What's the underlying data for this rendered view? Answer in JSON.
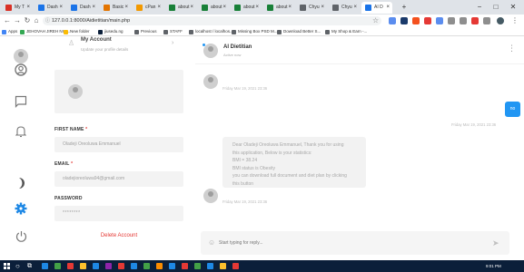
{
  "browser": {
    "tabs": [
      {
        "label": "My T",
        "color": "#d93025",
        "active": false
      },
      {
        "label": "Dash",
        "color": "#1a73e8",
        "active": false
      },
      {
        "label": "Dash",
        "color": "#1a73e8",
        "active": false
      },
      {
        "label": "Basic",
        "color": "#e37400",
        "active": false
      },
      {
        "label": "cPan",
        "color": "#f29900",
        "active": false
      },
      {
        "label": "about",
        "color": "#188038",
        "active": false
      },
      {
        "label": "about",
        "color": "#188038",
        "active": false
      },
      {
        "label": "about",
        "color": "#188038",
        "active": false
      },
      {
        "label": "about",
        "color": "#188038",
        "active": false
      },
      {
        "label": "Chyu",
        "color": "#5f6368",
        "active": false
      },
      {
        "label": "Chyu",
        "color": "#5f6368",
        "active": false
      },
      {
        "label": "AI D",
        "color": "#1a73e8",
        "active": true
      }
    ],
    "new_tab": "+",
    "controls": {
      "minimize": "−",
      "maximize": "□",
      "close": "✕"
    },
    "url": "127.0.0.1:8000/Aidietitian/main.php",
    "bookmarks": [
      {
        "label": "Apps",
        "color": "#4285f4"
      },
      {
        "label": "JEHOVAH JIREH NIG...",
        "color": "#34a853"
      },
      {
        "label": "New folder",
        "color": "#fbbc04"
      },
      {
        "label": "jiusedu.ng",
        "color": "#0b1f3a"
      },
      {
        "label": "Previous",
        "color": "#5f6368"
      },
      {
        "label": "STAFF",
        "color": "#5f6368"
      },
      {
        "label": "localhost / localhos...",
        "color": "#5f6368"
      },
      {
        "label": "Missing Box PSD M...",
        "color": "#5f6368"
      },
      {
        "label": "Download Better S...",
        "color": "#5f6368"
      },
      {
        "label": "My Shop & Earn -...",
        "color": "#5f6368"
      }
    ]
  },
  "profile": {
    "header_title": "My Account",
    "header_subtitle": "Update your profile details",
    "first_name_label": "FIRST NAME",
    "first_name_value": "Oladeji Oreoluwa Emmanuel",
    "email_label": "EMAIL",
    "email_value": "oladejioreoluwa94@gmail.com",
    "password_label": "PASSWORD",
    "password_value": "********",
    "required_mark": "*",
    "delete_label": "Delete Account"
  },
  "chat": {
    "contact_name": "AI Dietitian",
    "contact_status": "Active now",
    "messages": [
      {
        "time": "Friday Mar 19, 2021 23:36"
      },
      {
        "from_me": true,
        "text": "no",
        "time": "Friday Mar 19, 2021 23:36"
      },
      {
        "text": "Dear Oladeji Oreoluwa Emmanuel, Thank you for using this application, Below is your statistics: BMI = 38.24 BMI status is Obesity you can download full document and diet plan by clicking this button",
        "time": "Friday Mar 19, 2021 23:36"
      }
    ],
    "bubble_lines": [
      "Dear Oladeji Oreoluwa Emmanuel, Thank you for using",
      "this application, Below is your statistics:",
      "BMI = 38.24",
      "BMI status is Obesity",
      "you can download full document and diet plan by clicking",
      "this button"
    ],
    "input_placeholder": "Start typing for reply...",
    "send_icon": "send-icon"
  },
  "sidebar_icons": [
    "avatar",
    "user-icon",
    "chat-icon",
    "bell-icon",
    "moon-icon",
    "settings-icon",
    "power-icon"
  ],
  "taskbar": {
    "time": "9:01 PM",
    "icons": [
      "windows-icon",
      "search-icon",
      "task-view-icon"
    ]
  },
  "colors": {
    "accent": "#2196f3",
    "danger": "#e53935",
    "taskbar": "#0b1f3a"
  }
}
